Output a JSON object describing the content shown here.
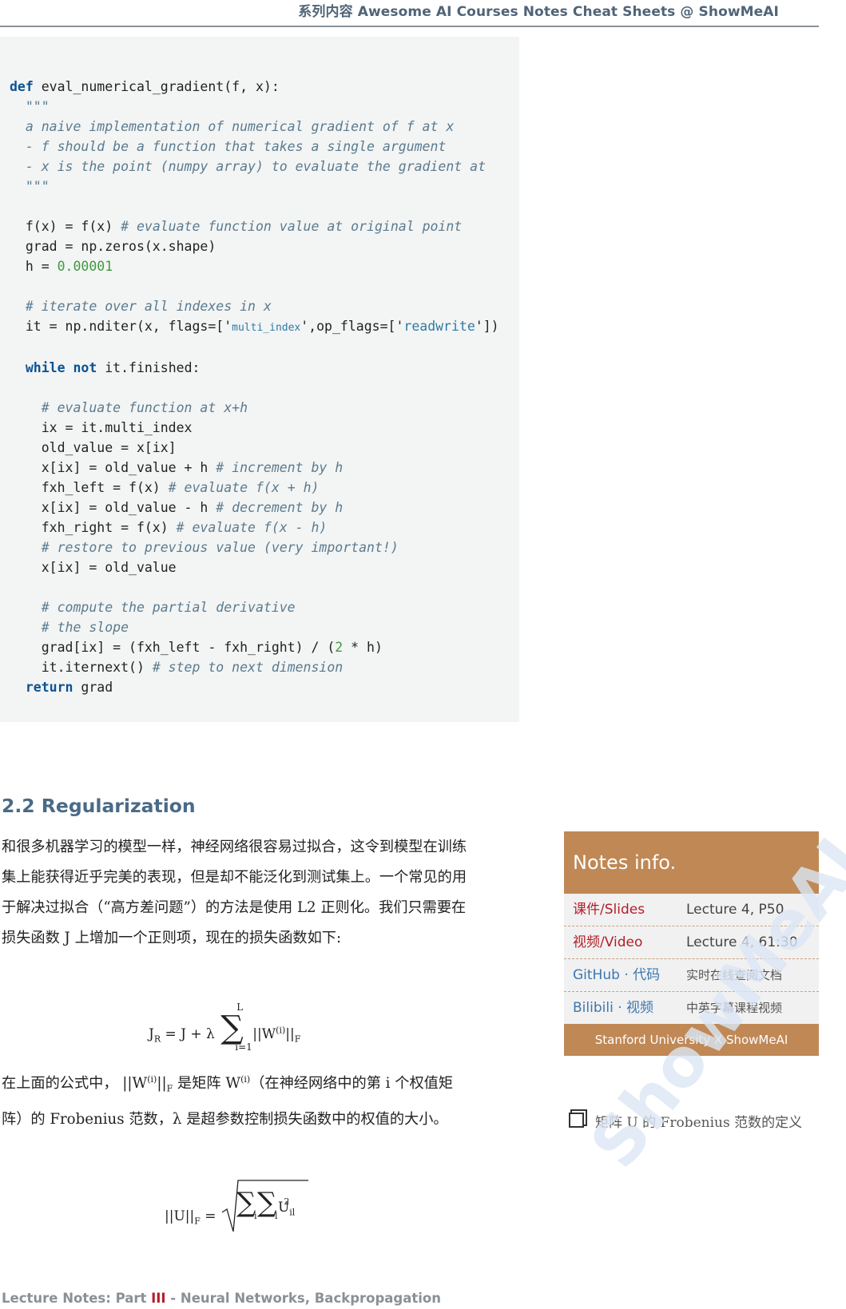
{
  "header": {
    "series_label": "系列内容",
    "site_title": "Awesome AI Courses Notes Cheat Sheets @ ShowMeAI"
  },
  "code": {
    "l1_kw": "def",
    "l1": " eval_numerical_gradient(f, x):",
    "l2": "  \"\"\"",
    "l3": "  a naive implementation of numerical gradient of f at x",
    "l4": "  - f should be a function that takes a single argument",
    "l5": "  - x is the point (numpy array) to evaluate the gradient at",
    "l6": "  \"\"\"",
    "l8a": "  f(x) = f(x) ",
    "l8c": "# evaluate function value at original point",
    "l9": "  grad = np.zeros(x.shape)",
    "l10a": "  h = ",
    "l10n": "0.00001",
    "l12": "  # iterate over all indexes in x",
    "l13a": "  it = np.nditer(x, flags=['",
    "l13s1": "multi_index",
    "l13b": "',op_flags=['",
    "l13s2": "readwrite",
    "l13c": "'])",
    "l15a": "  ",
    "l15k1": "while",
    "l15b": " ",
    "l15k2": "not",
    "l15c": " it.finished:",
    "l17": "    # evaluate function at x+h",
    "l18": "    ix = it.multi_index",
    "l19": "    old_value = x[ix]",
    "l20a": "    x[ix] = old_value + h ",
    "l20c": "# increment by h",
    "l21a": "    fxh_left = f(x) ",
    "l21c": "# evaluate f(x + h)",
    "l22a": "    x[ix] = old_value - h ",
    "l22c": "# decrement by h",
    "l23a": "    fxh_right = f(x) ",
    "l23c": "# evaluate f(x - h)",
    "l24": "    # restore to previous value (very important!)",
    "l25": "    x[ix] = old_value",
    "l27": "    # compute the partial derivative",
    "l28": "    # the slope",
    "l29a": "    grad[ix] = (fxh_left - fxh_right) / (",
    "l29n": "2",
    "l29b": " * h)",
    "l30a": "    it.iternext() ",
    "l30c": "# step to next dimension",
    "l31a": "  ",
    "l31k": "return",
    "l31b": " grad"
  },
  "section": {
    "title": "2.2 Regularization",
    "para1_a": "和很多机器学习的模型一样，神经网络很容易过拟合，这令到模型在训练集上能获得近乎完美的表现，但是却不能泛化到测试集上。一个常见的用于解决过拟合（“高方差问题”）的方法是使用 L2 正则化。我们只需要在损失函数 J 上增加一个正则项，现在的损失函数如下:",
    "formula1": {
      "lhs": "J",
      "lhs_sub": "R",
      "eq": " = J + λ ",
      "sum_top": "L",
      "sum_bot": "i=1",
      "norm_a": "||W",
      "norm_sup": "(i)",
      "norm_b": "||",
      "norm_sub": "F"
    },
    "para2_a": "在上面的公式中，",
    "para2_norm_a": " ||W",
    "para2_norm_sup": "(i)",
    "para2_norm_b": "||",
    "para2_norm_sub": "F",
    "para2_b": " 是矩阵 W",
    "para2_sup": "(i)",
    "para2_c": "（在神经网络中的第 i 个权值矩阵）的 Frobenius 范数，λ 是超参数控制损失函数中的权值的大小。",
    "formula2": {
      "lhs": "||U||",
      "lhs_sub": "F",
      "eq": " = ",
      "sub_i": "i",
      "sub_l": "l",
      "u": "U",
      "u_sub": "il",
      "u_sup": "2"
    }
  },
  "notes": {
    "title": "Notes info.",
    "rows": [
      {
        "k": "课件/Slides",
        "v": "Lecture 4, P50"
      },
      {
        "k": "视频/Video",
        "v": "Lecture 4, 61:30"
      },
      {
        "k": "GitHub · 代码",
        "v": "实时在线查阅文档"
      },
      {
        "k": "Bilibili · 视频",
        "v": "中英字幕课程视频"
      }
    ],
    "footer": "Stanford University  X  ShowMeAI"
  },
  "sidenote": {
    "text": "矩阵 U 的 Frobenius 范数的定义"
  },
  "watermark": "ShowMeAI",
  "footer": {
    "prefix": "Lecture Notes: Part ",
    "roman": "III",
    "suffix": " - Neural Networks, Backpropagation"
  }
}
